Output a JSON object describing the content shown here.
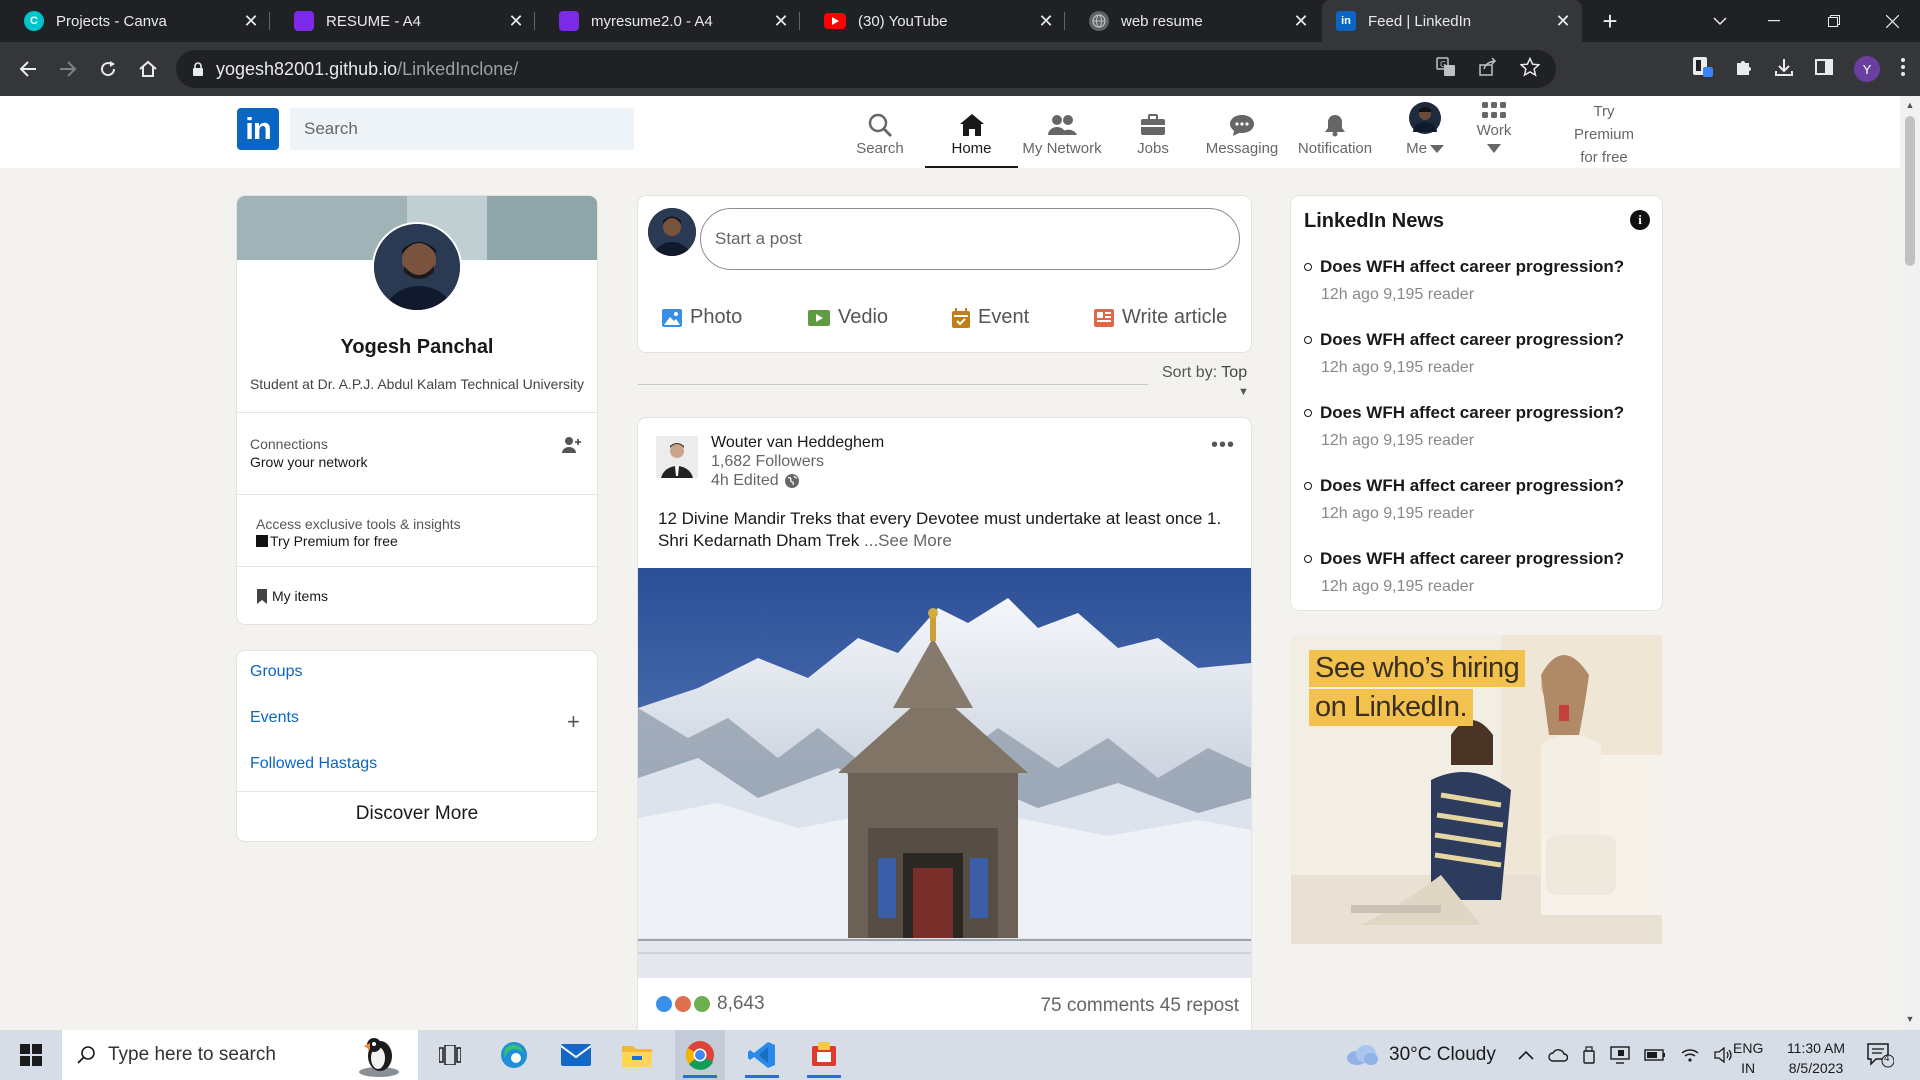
{
  "browser": {
    "tabs": [
      {
        "label": "Projects - Canva",
        "favicon": "canva-icon",
        "active": false
      },
      {
        "label": "RESUME - A4",
        "favicon": "doc-icon",
        "active": false
      },
      {
        "label": "myresume2.0 - A4",
        "favicon": "doc-icon",
        "active": false
      },
      {
        "label": "(30) YouTube",
        "favicon": "youtube-icon",
        "active": false
      },
      {
        "label": "web resume",
        "favicon": "globe-icon",
        "active": false
      },
      {
        "label": "Feed | LinkedIn",
        "favicon": "linkedin-icon",
        "active": true
      }
    ],
    "url_host": "yogesh82001.github.io",
    "url_path": "/LinkedInclone/",
    "profile_initial": "Y"
  },
  "header": {
    "logo_text": "in",
    "search_placeholder": "Search",
    "nav": [
      {
        "label": "Search",
        "icon": "search-icon"
      },
      {
        "label": "Home",
        "icon": "home-icon"
      },
      {
        "label": "My Network",
        "icon": "network-icon"
      },
      {
        "label": "Jobs",
        "icon": "briefcase-icon"
      },
      {
        "label": "Messaging",
        "icon": "messaging-icon"
      },
      {
        "label": "Notification",
        "icon": "bell-icon"
      },
      {
        "label": "Me",
        "icon": "avatar-icon"
      },
      {
        "label": "Work",
        "icon": "grid-icon"
      }
    ],
    "premium_lines": [
      "Try",
      "Premium",
      "for free"
    ]
  },
  "profile": {
    "name": "Yogesh Panchal",
    "headline": "Student at Dr. A.P.J. Abdul Kalam Technical University",
    "connections_label": "Connections",
    "connections_sub": "Grow your network",
    "access_label": "Access exclusive tools & insights",
    "premium_label": "Try Premium for free",
    "my_items_label": "My items"
  },
  "groups": {
    "links": [
      "Groups",
      "Events",
      "Followed Hastags"
    ],
    "discover": "Discover More"
  },
  "composer": {
    "placeholder": "Start a post",
    "actions": [
      {
        "label": "Photo",
        "icon": "photo-icon",
        "color": "#378fe9"
      },
      {
        "label": "Vedio",
        "icon": "video-icon",
        "color": "#5f9b41"
      },
      {
        "label": "Event",
        "icon": "calendar-icon",
        "color": "#c37d16"
      },
      {
        "label": "Write article",
        "icon": "article-icon",
        "color": "#e06847"
      }
    ],
    "sort_label": "Sort by:",
    "sort_value": "Top"
  },
  "post": {
    "author": "Wouter van Heddeghem",
    "followers": "1,682 Followers",
    "time": "4h Edited",
    "text": "12 Divine Mandir Treks that every Devotee must undertake at least once 1. Shri Kedarnath Dham Trek",
    "see_more": "...See More",
    "reaction_count": "8,643",
    "stats": "75 comments 45 repost"
  },
  "news": {
    "title": "LinkedIn News",
    "items": [
      {
        "headline": "Does WFH affect career progression?",
        "meta": "12h ago 9,195 reader"
      },
      {
        "headline": "Does WFH affect career progression?",
        "meta": "12h ago 9,195 reader"
      },
      {
        "headline": "Does WFH affect career progression?",
        "meta": "12h ago 9,195 reader"
      },
      {
        "headline": "Does WFH affect career progression?",
        "meta": "12h ago 9,195 reader"
      },
      {
        "headline": "Does WFH affect career progression?",
        "meta": "12h ago 9,195 reader"
      }
    ]
  },
  "ad": {
    "line1": "See who’s hiring",
    "line2": "on LinkedIn."
  },
  "taskbar": {
    "search_placeholder": "Type here to search",
    "weather": "30°C  Cloudy",
    "lang1": "ENG",
    "lang2": "IN",
    "time": "11:30 AM",
    "date": "8/5/2023",
    "notif_count": "4"
  },
  "colors": {
    "linkedin_blue": "#0a66c2",
    "page_bg": "#f3f2ef",
    "chrome_dark": "#202124"
  }
}
